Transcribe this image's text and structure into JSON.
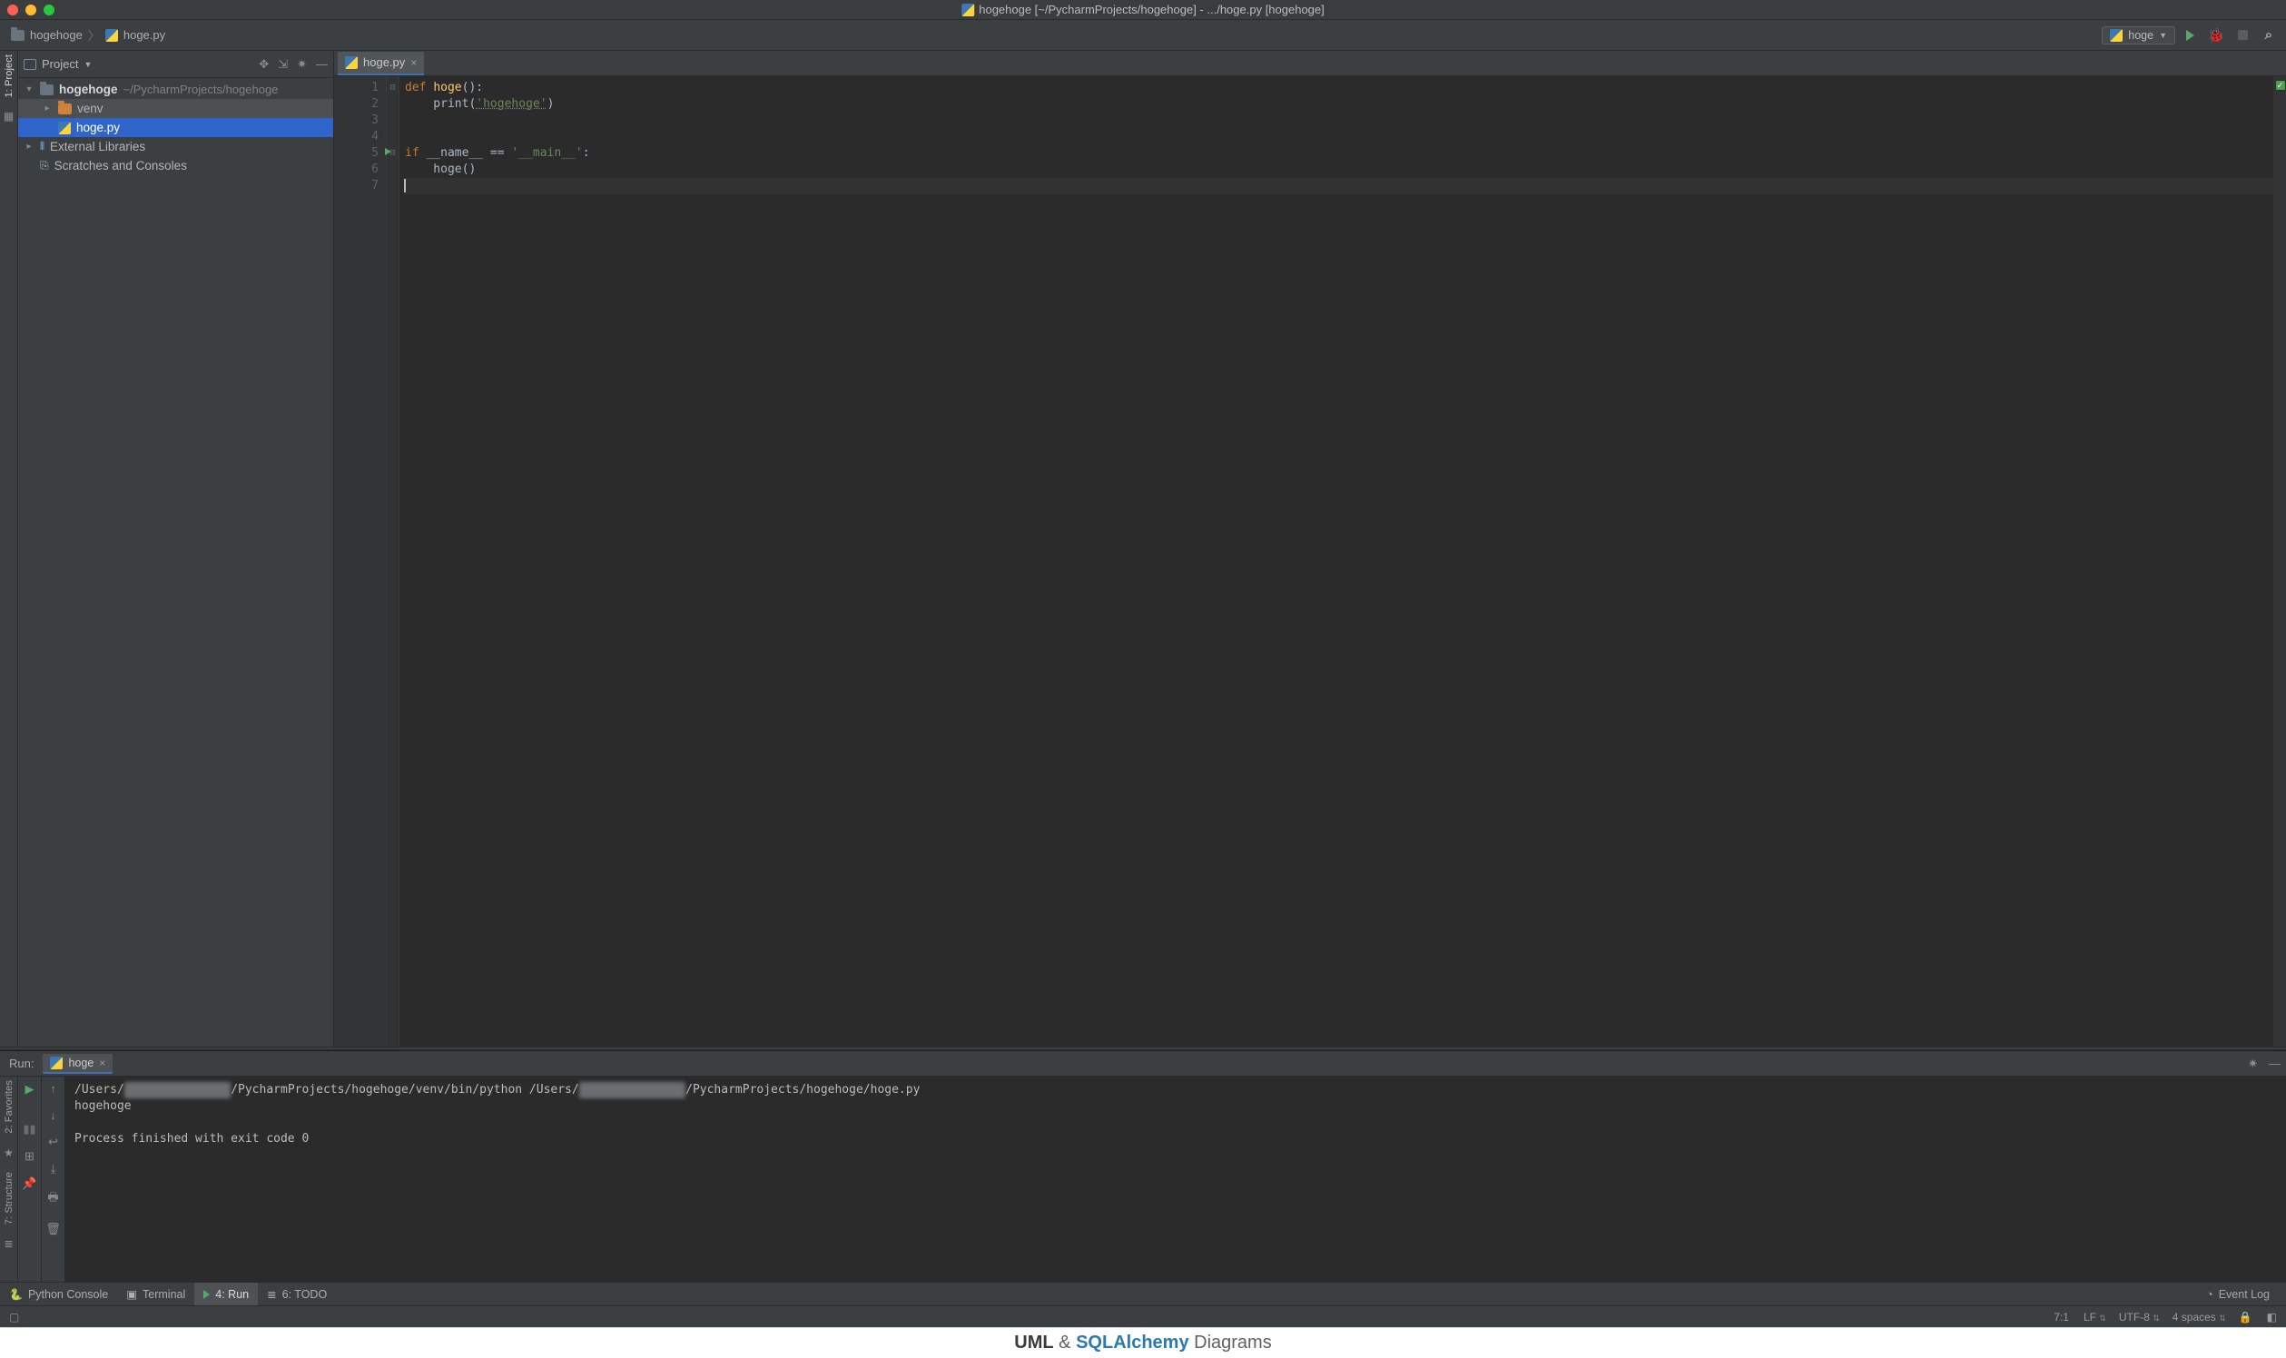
{
  "title": "hogehoge [~/PycharmProjects/hogehoge] - .../hoge.py [hogehoge]",
  "breadcrumbs": {
    "project": "hogehoge",
    "file": "hoge.py"
  },
  "run_config": {
    "name": "hoge"
  },
  "left_strip": {
    "project_label": "1: Project"
  },
  "project_pane": {
    "title": "Project",
    "root": {
      "name": "hogehoge",
      "path": "~/PycharmProjects/hogehoge"
    },
    "items": {
      "venv": "venv",
      "file": "hoge.py",
      "external": "External Libraries",
      "scratches": "Scratches and Consoles"
    }
  },
  "editor": {
    "tab": "hoge.py",
    "lines": [
      "1",
      "2",
      "3",
      "4",
      "5",
      "6",
      "7"
    ],
    "code": {
      "l1_def": "def ",
      "l1_fn": "hoge",
      "l1_rest": "():",
      "l2_pre": "    print(",
      "l2_str": "'hogehoge'",
      "l2_post": ")",
      "l5_if": "if ",
      "l5_name": "__name__",
      "l5_eq": " == ",
      "l5_main": "'__main__'",
      "l5_colon": ":",
      "l6": "    hoge()"
    }
  },
  "run_panel": {
    "label": "Run:",
    "tab": "hoge",
    "output_line1a": "/Users/",
    "output_line1_blur1": "xxxxxxxx xxxxxx",
    "output_line1b": "/PycharmProjects/hogehoge/venv/bin/python /Users/",
    "output_line1_blur2": "xxxxxxx  xxxxxx",
    "output_line1c": "/PycharmProjects/hogehoge/hoge.py",
    "output_line2": "hogehoge",
    "output_line4": "Process finished with exit code 0"
  },
  "left_strip_labels": {
    "favorites": "2: Favorites",
    "structure": "7: Structure"
  },
  "bottom_tools": {
    "python_console": "Python Console",
    "terminal": "Terminal",
    "run": "4: Run",
    "todo": "6: TODO",
    "event_log": "Event Log"
  },
  "status": {
    "pos": "7:1",
    "le": "LF",
    "enc": "UTF-8",
    "indent": "4 spaces"
  },
  "footer": {
    "uml": "UML",
    "amp": " & ",
    "sqlalchemy": "SQLAlchemy",
    "diagrams": " Diagrams"
  }
}
